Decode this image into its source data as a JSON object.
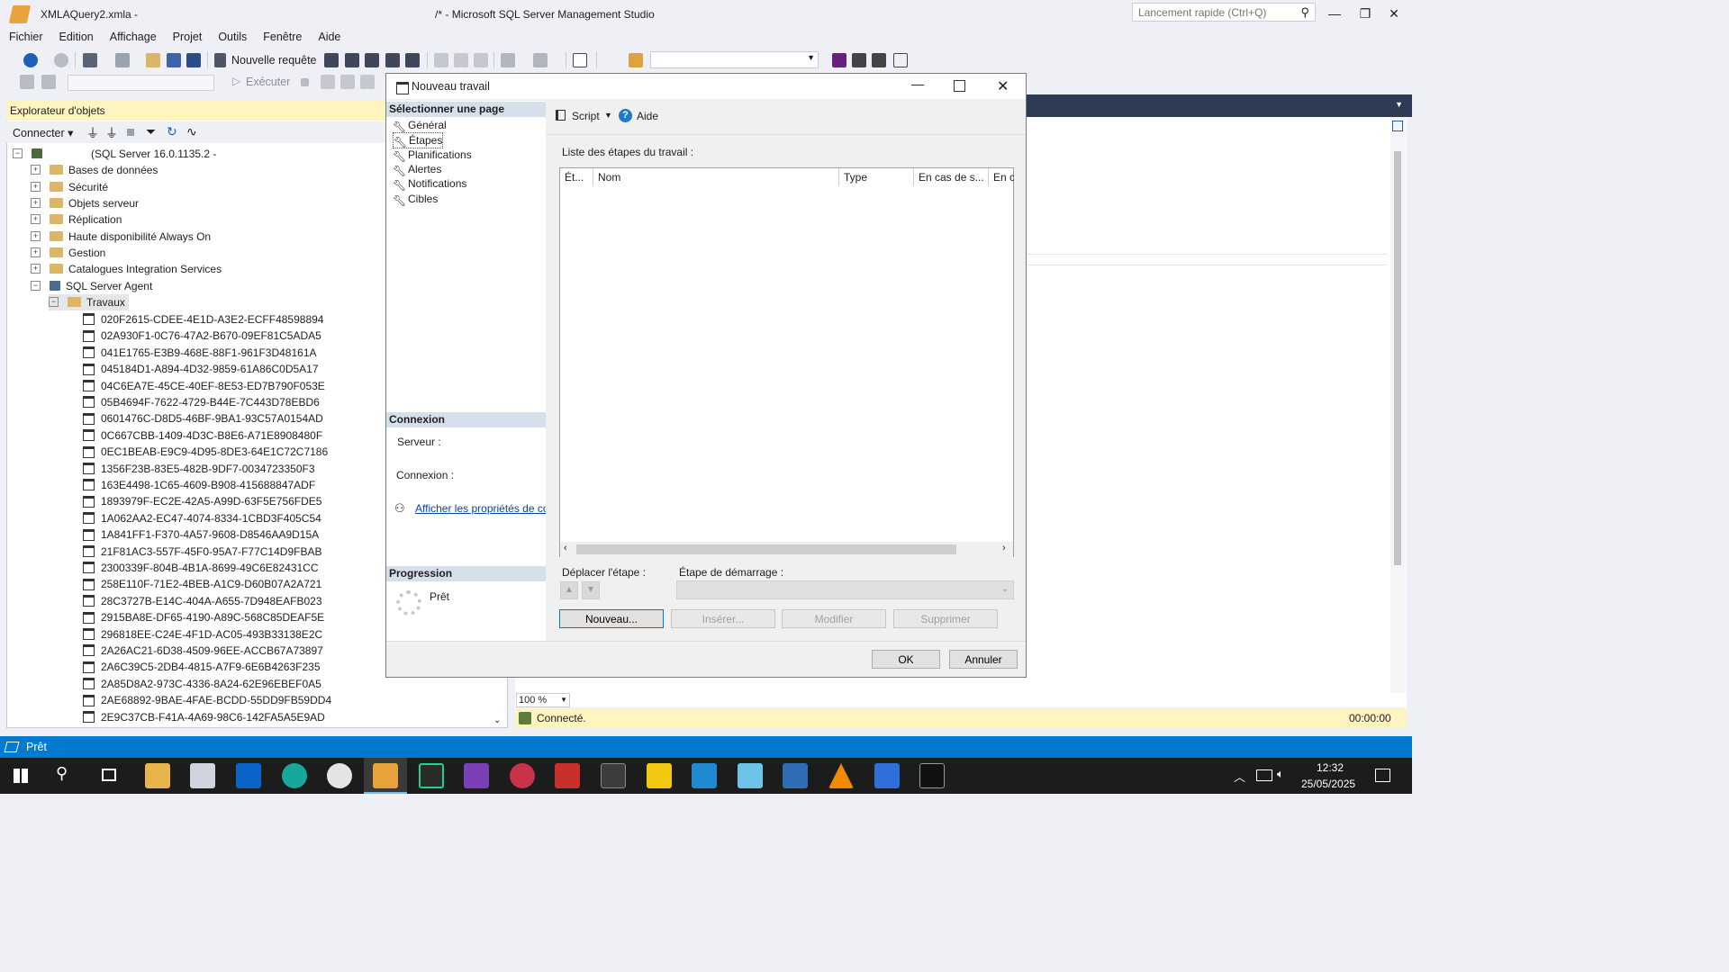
{
  "window": {
    "title_left": "XMLAQuery2.xmla -",
    "title_right": "/* - Microsoft SQL Server Management Studio",
    "quick_launch_placeholder": "Lancement rapide (Ctrl+Q)"
  },
  "menu": [
    "Fichier",
    "Edition",
    "Affichage",
    "Projet",
    "Outils",
    "Fenêtre",
    "Aide"
  ],
  "toolbar": {
    "new_query": "Nouvelle requête",
    "execute": "Exécuter"
  },
  "object_explorer": {
    "title": "Explorateur d'objets",
    "connect": "Connecter",
    "server_label": "(SQL Server 16.0.1135.2 -",
    "nodes": [
      "Bases de données",
      "Sécurité",
      "Objets serveur",
      "Réplication",
      "Haute disponibilité Always On",
      "Gestion",
      "Catalogues Integration Services"
    ],
    "agent": "SQL Server Agent",
    "jobs_folder": "Travaux",
    "jobs": [
      "020F2615-CDEE-4E1D-A3E2-ECFF48598894",
      "02A930F1-0C76-47A2-B670-09EF81C5ADA5",
      "041E1765-E3B9-468E-88F1-961F3D48161A",
      "045184D1-A894-4D32-9859-61A86C0D5A17",
      "04C6EA7E-45CE-40EF-8E53-ED7B790F053E",
      "05B4694F-7622-4729-B44E-7C443D78EBD6",
      "0601476C-D8D5-46BF-9BA1-93C57A0154AD",
      "0C667CBB-1409-4D3C-B8E6-A71E8908480F",
      "0EC1BEAB-E9C9-4D95-8DE3-64E1C72C7186",
      "1356F23B-83E5-482B-9DF7-0034723350F3",
      "163E4498-1C65-4609-B908-415688847ADF",
      "1893979F-EC2E-42A5-A99D-63F5E756FDE5",
      "1A062AA2-EC47-4074-8334-1CBD3F405C54",
      "1A841FF1-F370-4A57-9608-D8546AA9D15A",
      "21F81AC3-557F-45F0-95A7-F77C14D9FBAB",
      "2300339F-804B-4B1A-8699-49C6E82431CC",
      "258E110F-71E2-4BEB-A1C9-D60B07A2A721",
      "28C3727B-E14C-404A-A655-7D948EAFB023",
      "2915BA8E-DF65-4190-A89C-568C85DEAF5E",
      "296818EE-C24E-4F1D-AC05-493B33138E2C",
      "2A26AC21-6D38-4509-96EE-ACCB67A73897",
      "2A6C39C5-2DB4-4815-A7F9-6E6B4263F235",
      "2A85D8A2-973C-4336-8A24-62E96EBEF0A5",
      "2AE68892-9BAE-4FAE-BCDD-55DD9FB59DD4",
      "2E9C37CB-F41A-4A69-98C6-142FA5A5E9AD"
    ]
  },
  "dialog": {
    "title": "Nouveau travail",
    "select_page": "Sélectionner une page",
    "pages": [
      "Général",
      "Étapes",
      "Planifications",
      "Alertes",
      "Notifications",
      "Cibles"
    ],
    "script": "Script",
    "help": "Aide",
    "steps_list_label": "Liste des étapes du travail :",
    "columns": [
      "Ét...",
      "Nom",
      "Type",
      "En cas de s...",
      "En c"
    ],
    "connection_header": "Connexion",
    "server_label": "Serveur :",
    "connection_label": "Connexion :",
    "view_props_link": "Afficher les propriétés de conn",
    "progress_header": "Progression",
    "progress_status": "Prêt",
    "move_step": "Déplacer l'étape :",
    "start_step": "Étape de démarrage :",
    "buttons": {
      "new": "Nouveau...",
      "insert": "Insérer...",
      "edit": "Modifier",
      "delete": "Supprimer",
      "ok": "OK",
      "cancel": "Annuler"
    }
  },
  "editor": {
    "zoom": "100 %",
    "status": "Connecté.",
    "time": "00:00:00"
  },
  "statusbar": {
    "text": "Prêt"
  },
  "taskbar": {
    "time": "12:32",
    "date": "25/05/2025"
  }
}
